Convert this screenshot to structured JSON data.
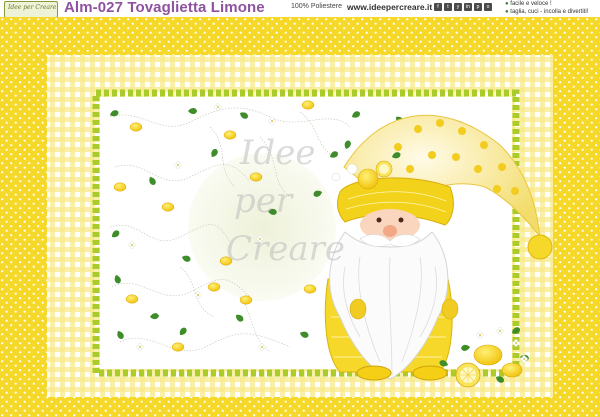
{
  "header": {
    "logo_text": "Idee per Creare",
    "title": "Alm-027 Tovaglietta Limone",
    "material": "100% Poliestere",
    "website": "www.ideepercreare.it",
    "social_icons": [
      "f",
      "t",
      "y",
      "in",
      "p",
      "o"
    ],
    "features": [
      "facile e veloce !",
      "taglia, cuci - incolla e divertiti!"
    ]
  },
  "placemat": {
    "watermark_lines": [
      "Idee",
      "per",
      "Creare"
    ]
  },
  "colors": {
    "outer_border": "#f6d829",
    "gingham": "#f7e47a",
    "rickrack": "#a9cc2a",
    "field": "#ffffff",
    "lemon": "#f5d21c",
    "leaf": "#3f8d2a",
    "title": "#8e52a0"
  }
}
